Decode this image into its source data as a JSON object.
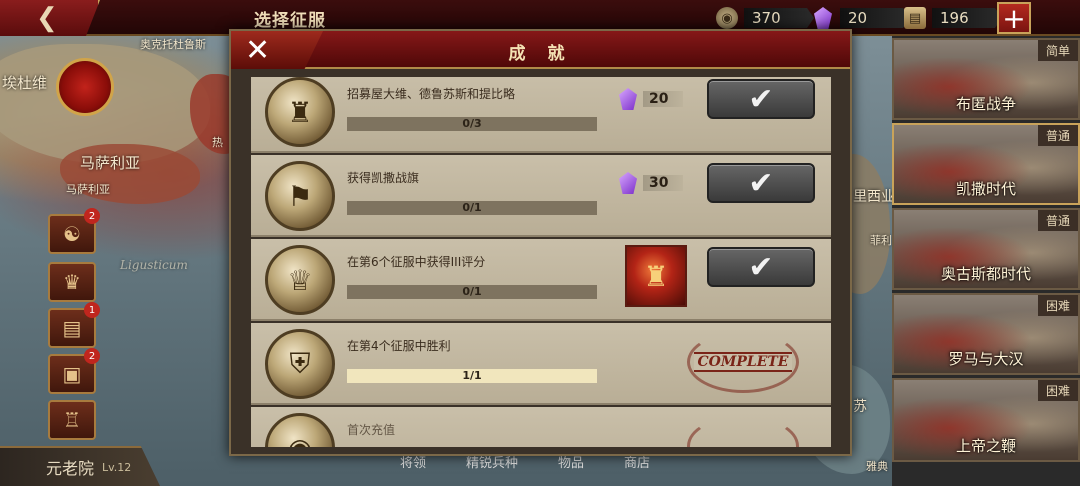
{
  "topbar": {
    "back_icon": "back-arrow-icon",
    "title": "选择征服",
    "resources": [
      {
        "icon": "coin-icon",
        "value": "370"
      },
      {
        "icon": "gem-icon",
        "value": "20"
      },
      {
        "icon": "scroll-icon",
        "value": "196"
      }
    ],
    "plus_label": "+"
  },
  "map": {
    "labels": [
      "埃杜维",
      "奥克托杜鲁斯",
      "马萨利亚",
      "马萨利亚",
      "热",
      "里西业",
      "菲利",
      "苏",
      "雅典",
      "Ligusticum"
    ]
  },
  "sidebar": {
    "buttons": [
      {
        "icon": "money-bag-icon",
        "badge": "2"
      },
      {
        "icon": "laurel-crown-icon",
        "badge": ""
      },
      {
        "icon": "film-icon",
        "badge": "1"
      },
      {
        "icon": "chest-icon",
        "badge": "2"
      },
      {
        "icon": "trophy-icon",
        "badge": ""
      }
    ],
    "senate": {
      "label": "元老院",
      "level": "Lv.12"
    }
  },
  "eras": [
    {
      "name": "布匿战争",
      "difficulty": "简单"
    },
    {
      "name": "凯撒时代",
      "difficulty": "普通"
    },
    {
      "name": "奥古斯都时代",
      "difficulty": "普通"
    },
    {
      "name": "罗马与大汉",
      "difficulty": "困难"
    },
    {
      "name": "上帝之鞭",
      "difficulty": "困难"
    }
  ],
  "dialog": {
    "title": "成 就",
    "close_icon": "close-x-icon",
    "achievements": [
      {
        "text": "招募屋大维、德鲁苏斯和提比略",
        "progress": "0/3",
        "fraction": 0,
        "reward_type": "gem",
        "reward": "20",
        "state": "claim",
        "medal_icon": "helmet-medal-icon"
      },
      {
        "text": "获得凯撒战旗",
        "progress": "0/1",
        "fraction": 0,
        "reward_type": "gem",
        "reward": "30",
        "state": "claim",
        "medal_icon": "banner-medal-icon"
      },
      {
        "text": "在第6个征服中获得III评分",
        "progress": "0/1",
        "fraction": 0,
        "reward_type": "helmet",
        "reward": "",
        "state": "claim",
        "medal_icon": "eagle-medal-icon"
      },
      {
        "text": "在第4个征服中胜利",
        "progress": "1/1",
        "fraction": 1,
        "reward_type": "none",
        "reward": "",
        "state": "complete",
        "complete_label": "COMPLETE",
        "medal_icon": "shield-medal-icon"
      },
      {
        "text": "首次充值",
        "progress": "",
        "fraction": 0,
        "reward_type": "none",
        "reward": "",
        "state": "complete",
        "complete_label": "",
        "medal_icon": "coins-medal-icon"
      }
    ]
  },
  "bottom_tabs": [
    "将领",
    "精锐兵种",
    "物品",
    "商店"
  ]
}
